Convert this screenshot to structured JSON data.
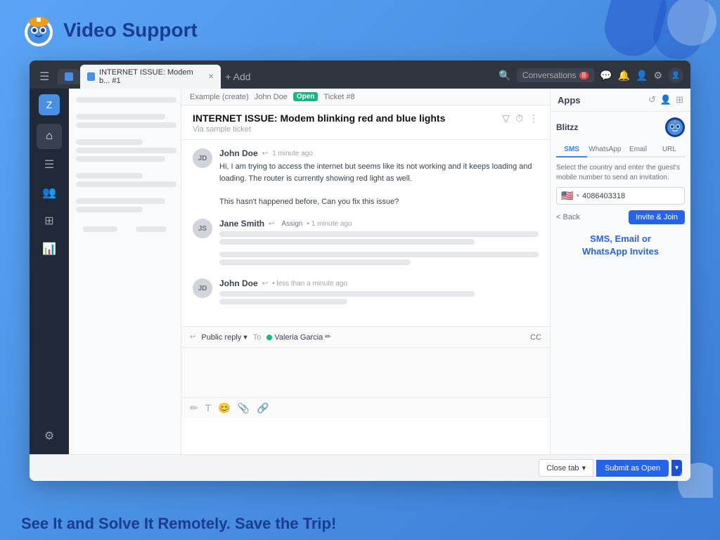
{
  "header": {
    "logo_text": "Video Support",
    "tagline": "See It and Solve It Remotely. Save the Trip!"
  },
  "browser": {
    "tab_title": "INTERNET ISSUE: Modem b... #1",
    "tab_add_label": "+ Add",
    "conversations_label": "Conversations",
    "conversations_count": "8"
  },
  "breadcrumb": {
    "example_label": "Example (create)",
    "user_label": "John Doe",
    "status_label": "Open",
    "ticket_label": "Ticket #8"
  },
  "ticket": {
    "title": "INTERNET ISSUE: Modem blinking red and blue lights",
    "source": "Via sample ticket"
  },
  "messages": [
    {
      "author": "John Doe",
      "time": "1 minute ago",
      "text": "Hi, I am trying to access the internet but seems like its not working and it keeps loading and loading. The router is currently showing red light as well.\n\nThis hasn't happened before, Can you fix this issue?",
      "is_skeleton": false
    },
    {
      "author": "Jane Smith",
      "assign_label": "Assign",
      "time": "1 minute ago",
      "is_skeleton": true
    },
    {
      "author": "John Doe",
      "time": "less than a minute ago",
      "is_skeleton": true
    }
  ],
  "reply": {
    "type_label": "Public reply",
    "to_label": "To",
    "recipient": "Valeria Garcia",
    "cc_label": "CC"
  },
  "apps_panel": {
    "title": "Apps",
    "blitzz_label": "Blitzz",
    "tabs": [
      "SMS",
      "WhatsApp",
      "Email",
      "URL"
    ],
    "active_tab": "SMS",
    "invite_instruction": "Select the country and enter the guest's mobile number to send an invitation.",
    "phone_flag": "🇺🇸",
    "phone_number": "4086403318",
    "back_label": "< Back",
    "invite_btn_label": "Invite & Join",
    "promo_text": "SMS, Email or\nWhatsApp Invites"
  },
  "bottom_bar": {
    "close_tab_label": "Close tab",
    "submit_label": "Submit as Open"
  },
  "sidebar": {
    "items": [
      {
        "name": "home",
        "icon": "⌂"
      },
      {
        "name": "book",
        "icon": "☰"
      },
      {
        "name": "users",
        "icon": "👥"
      },
      {
        "name": "grid",
        "icon": "⊞"
      },
      {
        "name": "chart",
        "icon": "📊"
      },
      {
        "name": "settings",
        "icon": "⚙"
      }
    ]
  }
}
